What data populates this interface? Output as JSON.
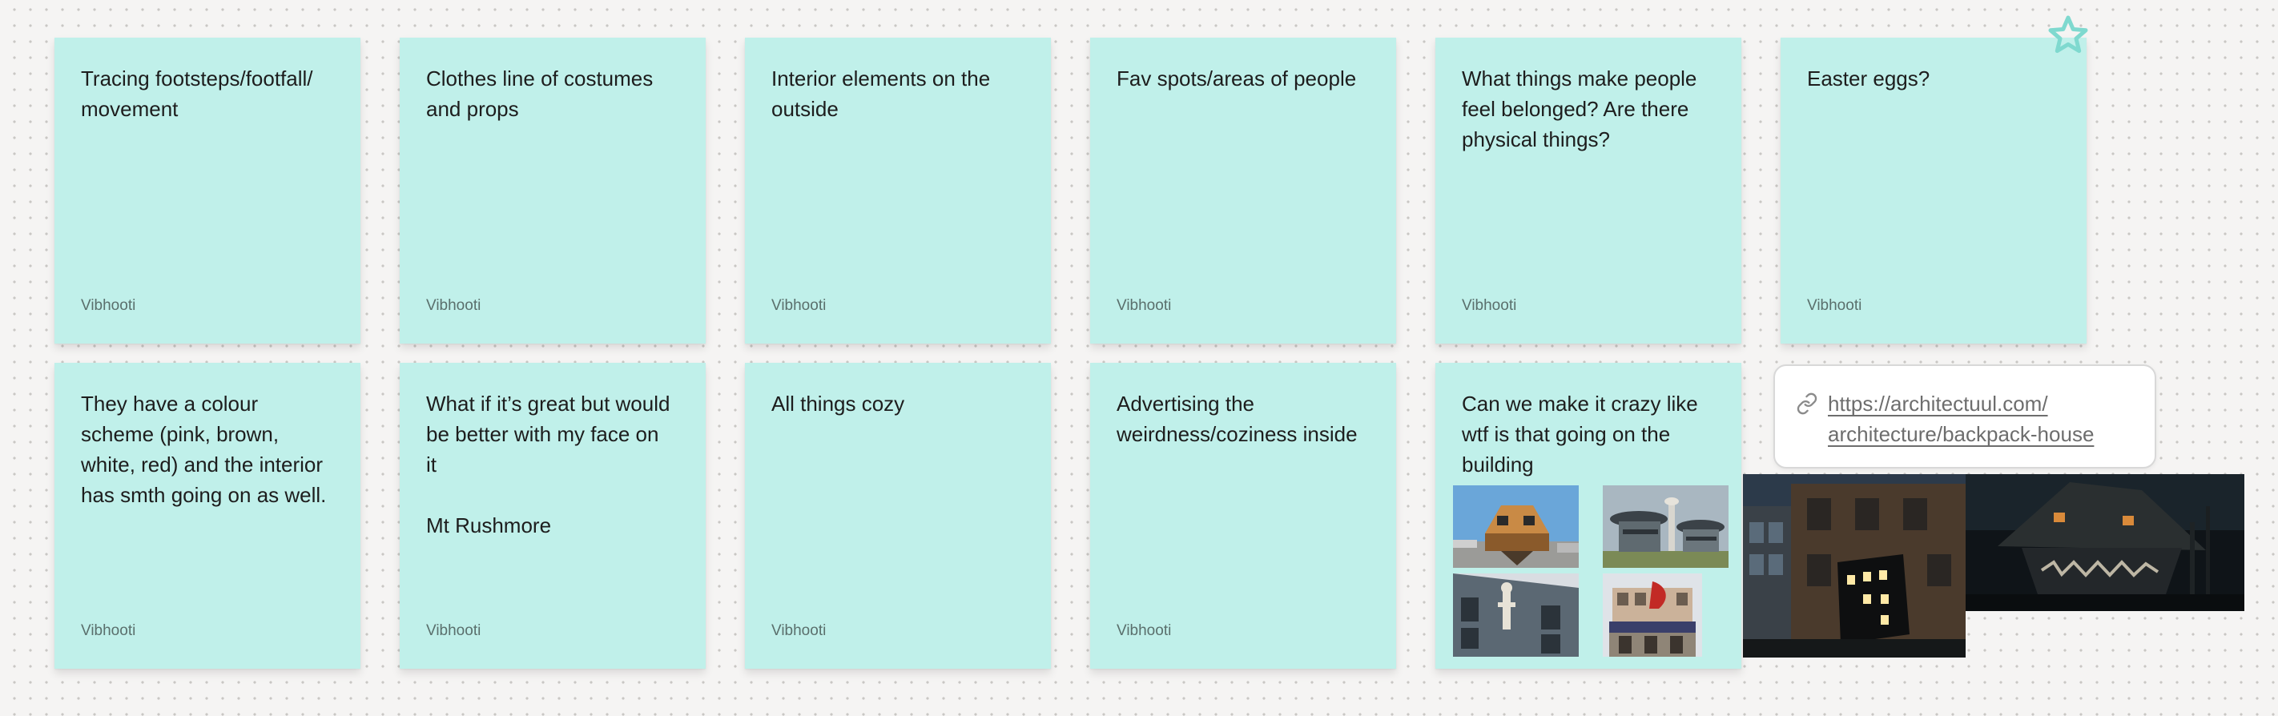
{
  "notes": [
    {
      "text": "Tracing footsteps/footfall/\nmovement",
      "author": "Vibhooti"
    },
    {
      "text": "Clothes line of costumes\nand props",
      "author": "Vibhooti"
    },
    {
      "text": "Interior elements on the\noutside",
      "author": "Vibhooti"
    },
    {
      "text": "Fav spots/areas of people",
      "author": "Vibhooti"
    },
    {
      "text": "What things make people\nfeel belonged? Are there\nphysical things?",
      "author": "Vibhooti"
    },
    {
      "text": "Easter eggs?",
      "author": "Vibhooti"
    },
    {
      "text": "They have a colour\nscheme (pink, brown,\nwhite, red) and the interior\nhas smth going on as well.",
      "author": "Vibhooti"
    },
    {
      "text": "What if it’s great but would\nbe better with my face on\nit\n\nMt Rushmore",
      "author": "Vibhooti"
    },
    {
      "text": "All things cozy",
      "author": "Vibhooti"
    },
    {
      "text": "Advertising the\nweirdness/coziness inside",
      "author": "Vibhooti"
    },
    {
      "text": "Can we make it crazy like\nwtf is that going on the\nbuilding",
      "author": ""
    }
  ],
  "link_card": {
    "url_text": "https://architectuul.com/\narchitecture/backpack-house",
    "icon": "link-icon"
  },
  "images": [
    {
      "name": "upside-down-house-photo",
      "icon": "photo"
    },
    {
      "name": "futuristic-building-photo",
      "icon": "photo"
    },
    {
      "name": "wall-sculpture-building-photo",
      "icon": "photo"
    },
    {
      "name": "theatre-facade-photo",
      "icon": "photo"
    },
    {
      "name": "backpack-house-photo",
      "icon": "photo"
    },
    {
      "name": "monster-house-photo",
      "icon": "photo"
    }
  ],
  "colors": {
    "note_bg": "#c0f0ea",
    "star_outline": "#7fd9cf",
    "canvas_bg": "#f5f4f3"
  },
  "star": {
    "icon": "star-icon"
  }
}
